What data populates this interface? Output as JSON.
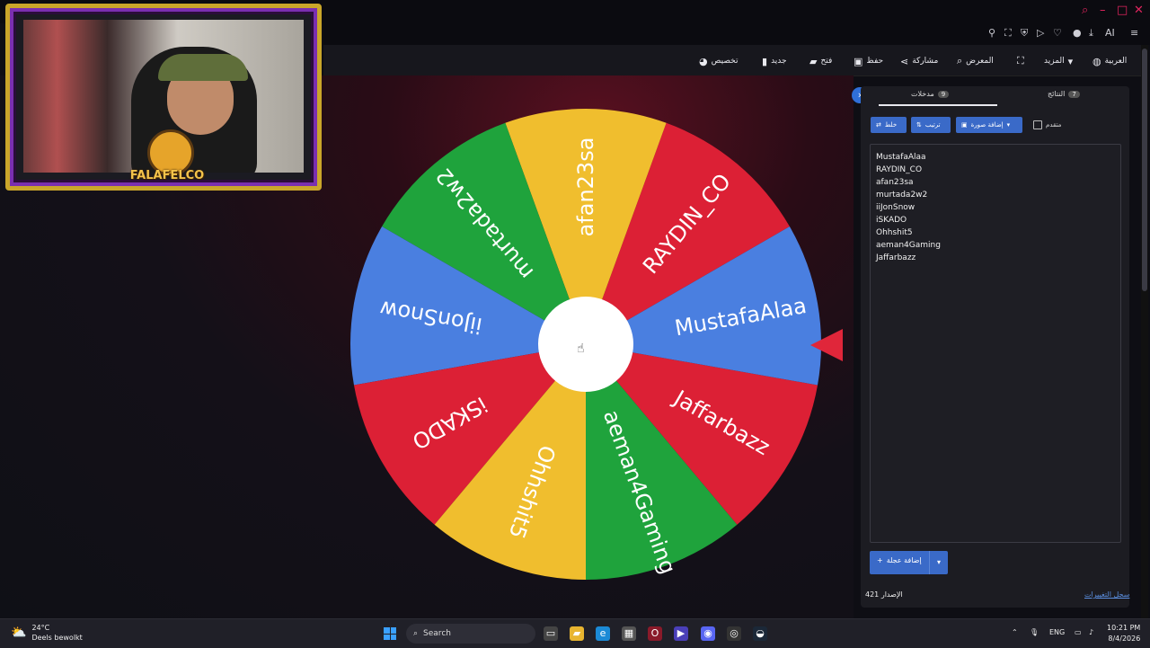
{
  "browser": {
    "window_controls": [
      "search",
      "minimize",
      "maximize",
      "close"
    ],
    "ai_label": "AI"
  },
  "toolbar": {
    "items": [
      {
        "label": "العربية",
        "icon": "globe-icon"
      },
      {
        "label": "المزيد",
        "icon": "caret-down-icon"
      },
      {
        "label": "",
        "icon": "fullscreen-icon"
      },
      {
        "label": "المعرض",
        "icon": "search-icon"
      },
      {
        "label": "مشاركة",
        "icon": "share-icon"
      },
      {
        "label": "حفظ",
        "icon": "save-icon"
      },
      {
        "label": "فتح",
        "icon": "folder-icon"
      },
      {
        "label": "جديد",
        "icon": "file-icon"
      },
      {
        "label": "تخصيص",
        "icon": "palette-icon"
      }
    ]
  },
  "webcam": {
    "logo_text": "FALAFELCO"
  },
  "wheel": {
    "segments": [
      {
        "label": "RAYDIN_CO",
        "color": "#dc2035"
      },
      {
        "label": "afan23sa",
        "color": "#f0be2e"
      },
      {
        "label": "murtada2w2",
        "color": "#1fa33c"
      },
      {
        "label": "iiJonSnow",
        "color": "#4a7fe0"
      },
      {
        "label": "iSKADO",
        "color": "#dc2035"
      },
      {
        "label": "Ohhshit5",
        "color": "#f0be2e"
      },
      {
        "label": "aeman4Gaming",
        "color": "#1fa33c"
      },
      {
        "label": "Jaffarbazz",
        "color": "#dc2035"
      },
      {
        "label": "MustafaAlaa",
        "color": "#4a7fe0"
      }
    ],
    "pointer_color": "#e0263a"
  },
  "panel": {
    "tab_results": {
      "label": "النتائج",
      "count": "7"
    },
    "tab_entries": {
      "label": "مدخلات",
      "count": "9"
    },
    "shuffle_label": "خلط",
    "sort_label": "ترتيب",
    "add_image_label": "إضافة صورة",
    "advanced_label": "متقدم",
    "entries": [
      "MustafaAlaa",
      "RAYDIN_CO",
      "afan23sa",
      "murtada2w2",
      "iiJonSnow",
      "iSKADO",
      "Ohhshit5",
      "aeman4Gaming",
      "Jaffarbazz"
    ],
    "add_wheel_label": "إضافة عجلة",
    "version_label": "الإصدار",
    "version_number": "421",
    "changelog_label": "سجل التغييرات"
  },
  "taskbar": {
    "weather_temp": "24°C",
    "weather_desc": "Deels bewolkt",
    "search_placeholder": "Search",
    "language": "ENG",
    "time": "10:21 PM",
    "date": "8/4/2026"
  },
  "colors": {
    "accent": "#3a6ac8",
    "brand_red": "#e0245e"
  }
}
